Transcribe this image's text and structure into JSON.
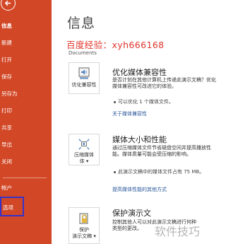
{
  "sidebar": {
    "items": [
      {
        "label": "信息",
        "active": true
      },
      {
        "label": "新建"
      },
      {
        "label": "打开"
      },
      {
        "label": "保存"
      },
      {
        "label": "另存为"
      },
      {
        "label": "打印"
      },
      {
        "label": "共享"
      },
      {
        "label": "导出"
      },
      {
        "label": "关闭"
      },
      {
        "label": "帐户"
      },
      {
        "label": "选项",
        "highlighted": true
      }
    ]
  },
  "main": {
    "title": "信息",
    "watermark": "百度经验：xyh666168",
    "breadcrumb": "Documents",
    "sections": [
      {
        "tile_label": "优化兼容性",
        "title": "优化媒体兼容性",
        "desc": "是否计划在其他计算机上传递此演示文稿？优化媒体兼容性可改进它的体验。",
        "bullet": "可以优化 1 个媒体文件。",
        "link": "关于媒体兼容性"
      },
      {
        "tile_label": "压缩媒体",
        "tile_label2": "体 ▾",
        "title": "媒体大小和性能",
        "desc": "通过压缩媒体文件节省磁盘空间并提高播放性能。媒体质量可能会受压缩的影响。",
        "bullet": "此演示文稿中的媒体文件占有 75 MB。",
        "link": "提高媒体性能的其他方式"
      },
      {
        "tile_label": "保护",
        "tile_label2": "演示文稿 ▾",
        "title": "保护演示文",
        "desc": "控制其他人可以对此演示文稿进行何种类型的更改。"
      }
    ]
  },
  "watermark_bottom": "软件技巧",
  "colors": {
    "sidebar_bg": "#d24726",
    "highlight_border": "#3333cc",
    "link": "#2b579a",
    "watermark_red": "#e0352b"
  }
}
